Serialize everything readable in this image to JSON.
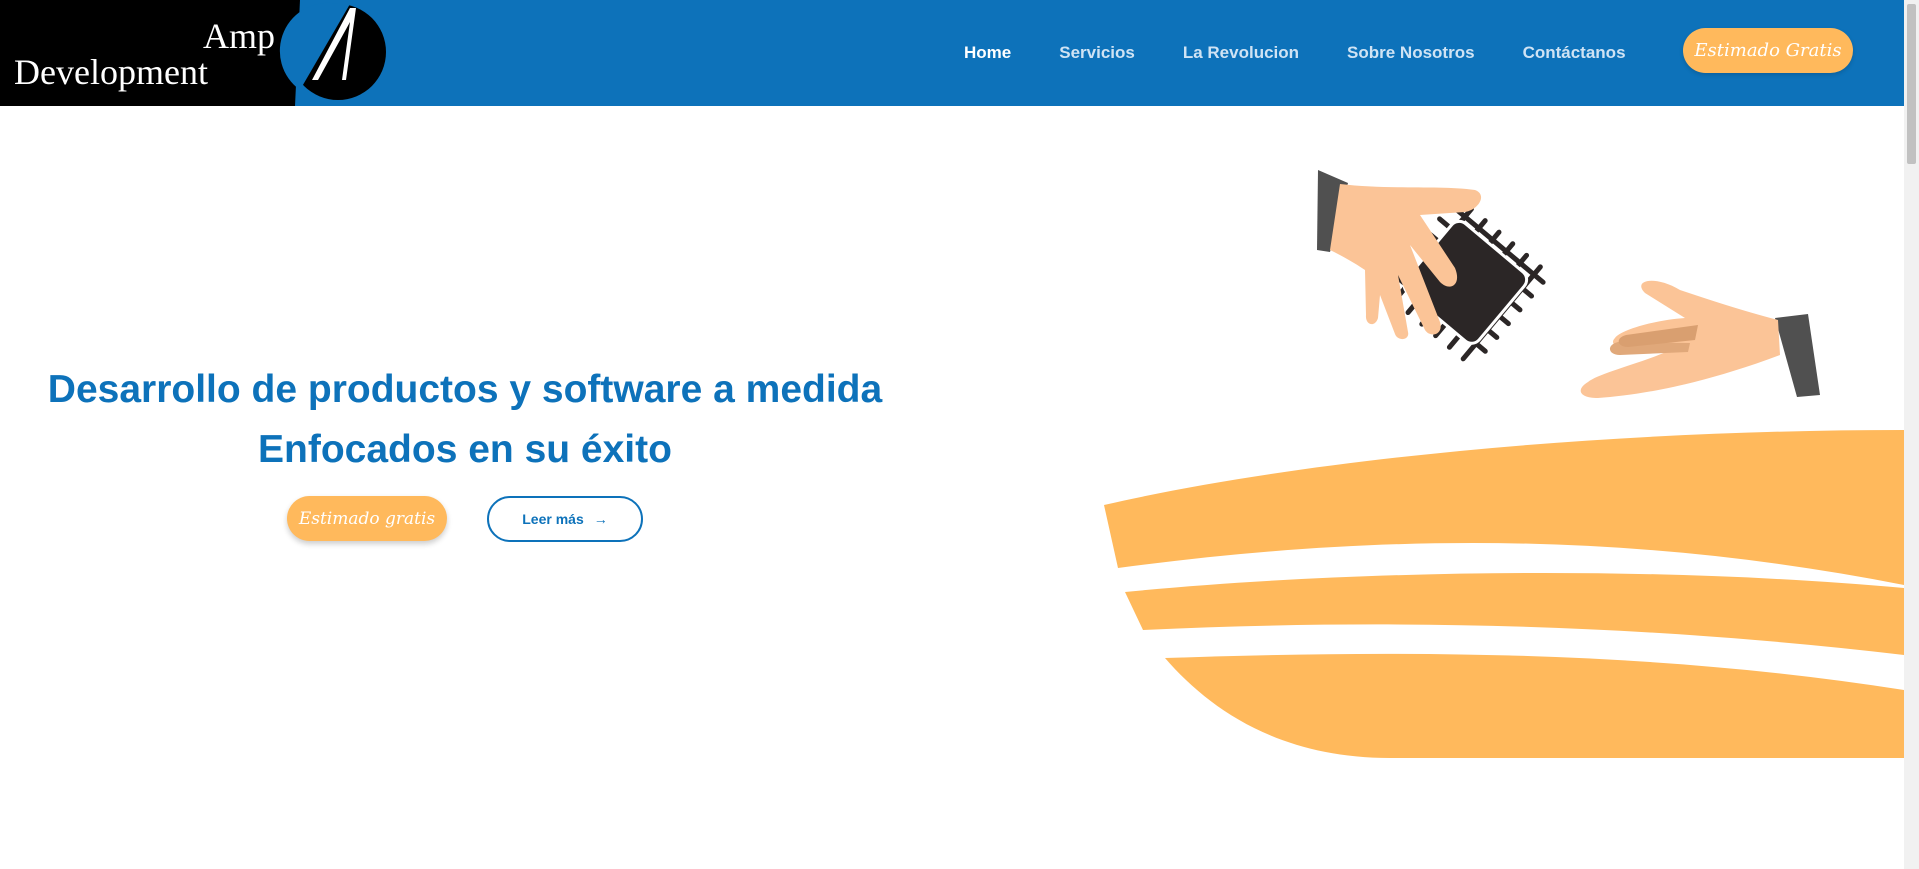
{
  "logo": {
    "line1": "Amp",
    "line2": "Development"
  },
  "nav": {
    "items": [
      {
        "label": "Home",
        "active": true
      },
      {
        "label": "Servicios"
      },
      {
        "label": "La Revolucion"
      },
      {
        "label": "Sobre Nosotros"
      },
      {
        "label": "Contáctanos"
      }
    ],
    "cta_label": "Estimado Gratis"
  },
  "hero": {
    "title_line1": "Desarrollo de productos y software a medida",
    "title_line2": "Enfocados en su éxito",
    "primary_button": "Estimado gratis",
    "secondary_button": "Leer más",
    "secondary_icon": "arrow-right-icon"
  },
  "colors": {
    "brand_blue": "#0d72ba",
    "accent_orange": "#ffb95c",
    "skin": "#fbc497",
    "chip_dark": "#2b2626"
  }
}
